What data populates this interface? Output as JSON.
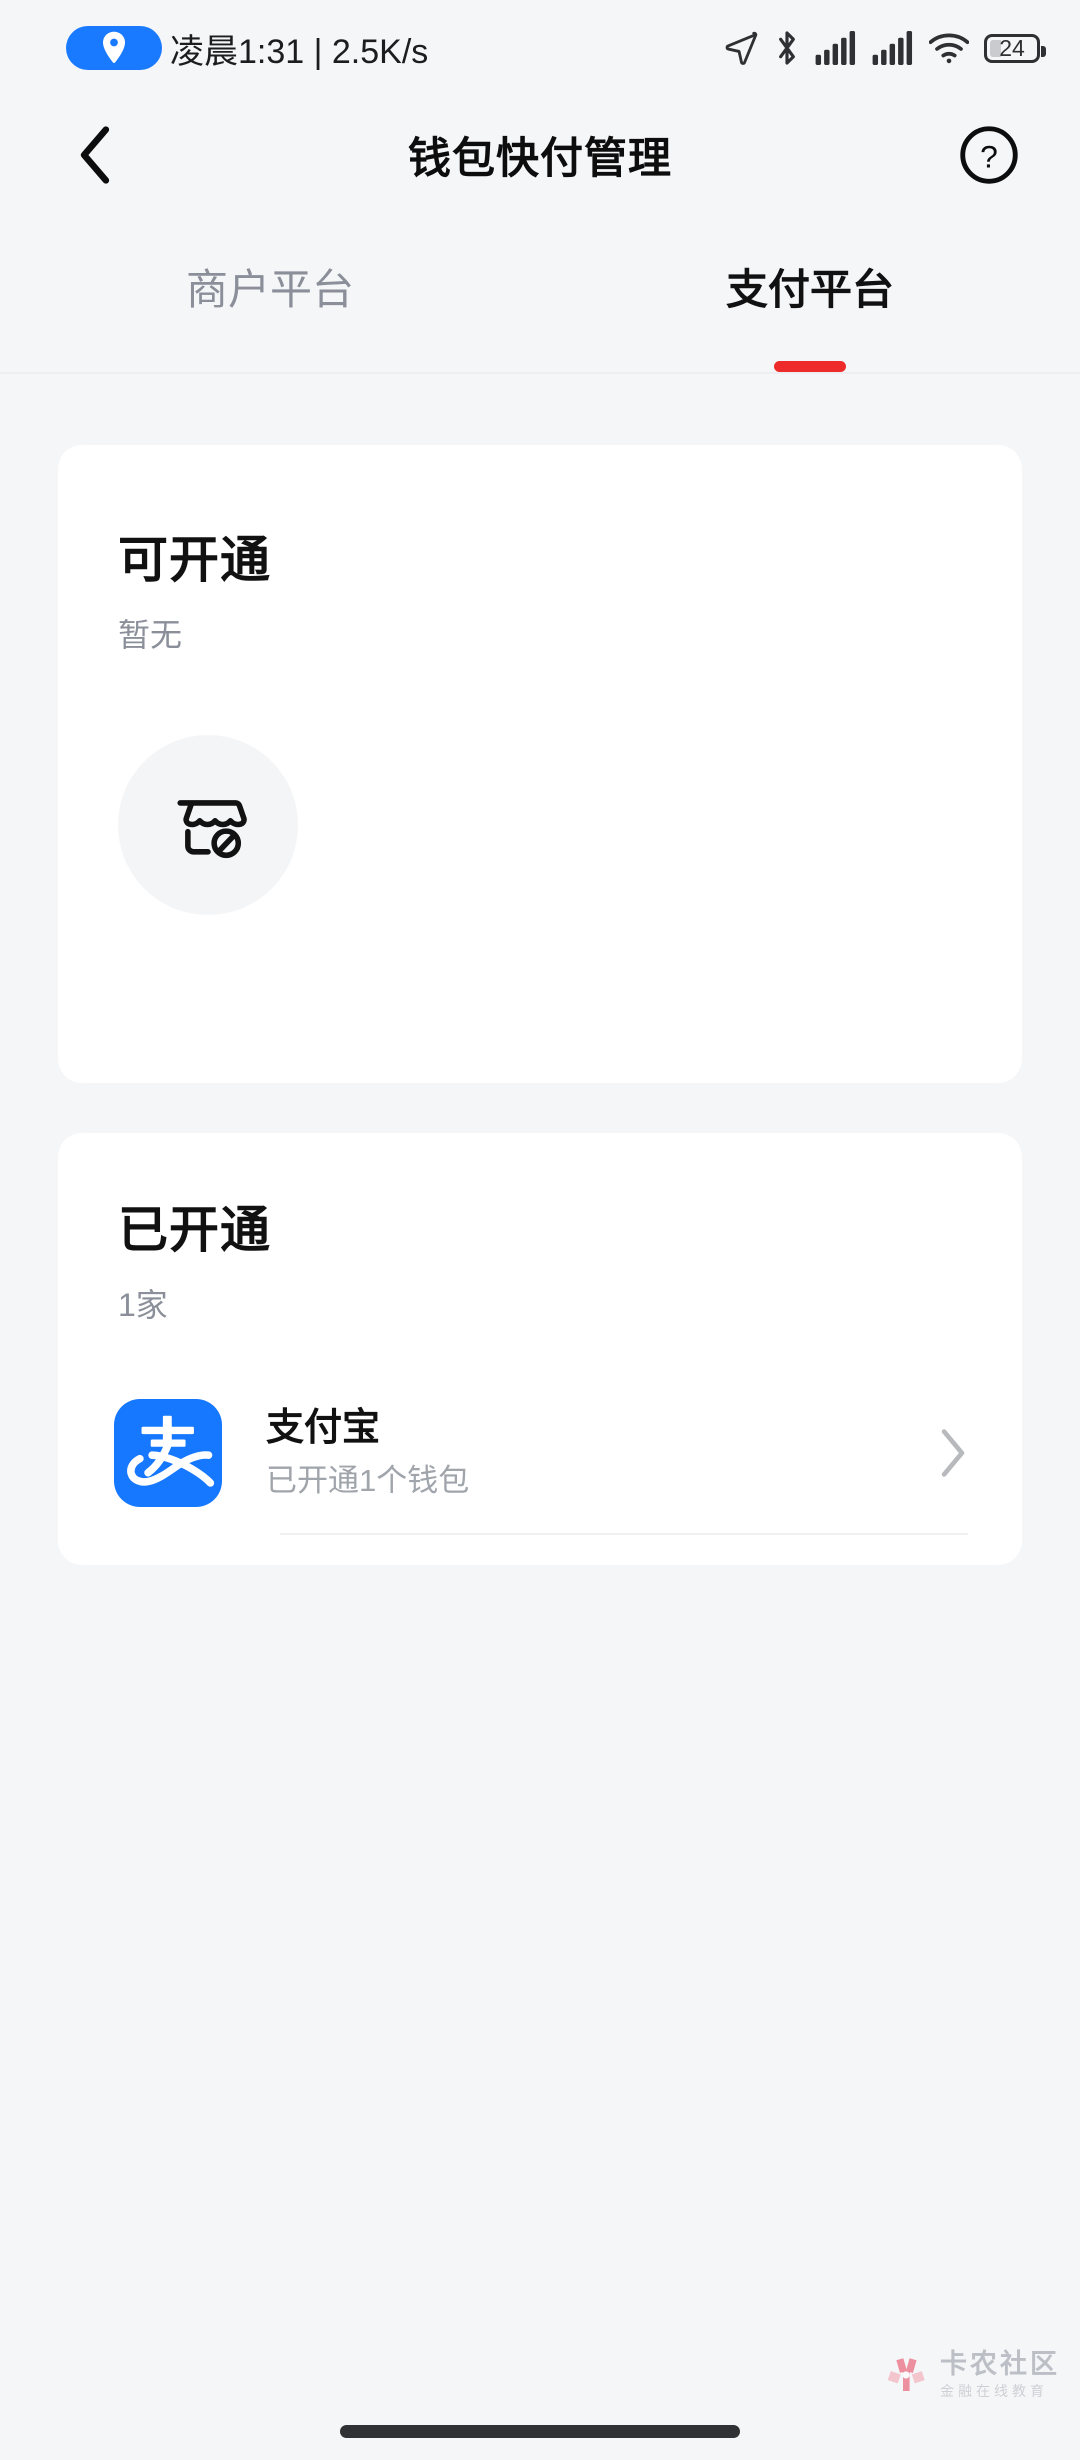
{
  "statusbar": {
    "location_icon": "location-pin-icon",
    "time": "凌晨1:31 | 2.5K/s",
    "icons": [
      "navigation-arrow-icon",
      "bluetooth-icon",
      "signal-bars-icon",
      "signal-bars-2-icon",
      "wifi-icon"
    ],
    "battery_percent": "24"
  },
  "header": {
    "back_icon": "back-chevron-icon",
    "title": "钱包快付管理",
    "help_icon": "help-circle-icon"
  },
  "tabs": {
    "items": [
      {
        "label": "商户平台",
        "active": false
      },
      {
        "label": "支付平台",
        "active": true
      }
    ],
    "active_index": 1,
    "indicator_color": "#ee2b2b"
  },
  "cards": {
    "available": {
      "title": "可开通",
      "subtitle": "暂无",
      "empty_icon": "store-disabled-icon"
    },
    "opened": {
      "title": "已开通",
      "subtitle": "1家",
      "merchants": [
        {
          "icon": "alipay-icon",
          "icon_color": "#1677ff",
          "name": "支付宝",
          "desc": "已开通1个钱包",
          "chevron": "chevron-right-icon"
        }
      ]
    }
  },
  "watermark": {
    "logo": "kanong-flower-logo-icon",
    "main": "卡农社区",
    "sub": "金融在线教育"
  },
  "colors": {
    "page_background": "#f5f6f8",
    "card_background": "#ffffff",
    "accent_red": "#ee2b2b",
    "alipay_blue": "#1677ff",
    "muted_text": "#8a8f99"
  }
}
